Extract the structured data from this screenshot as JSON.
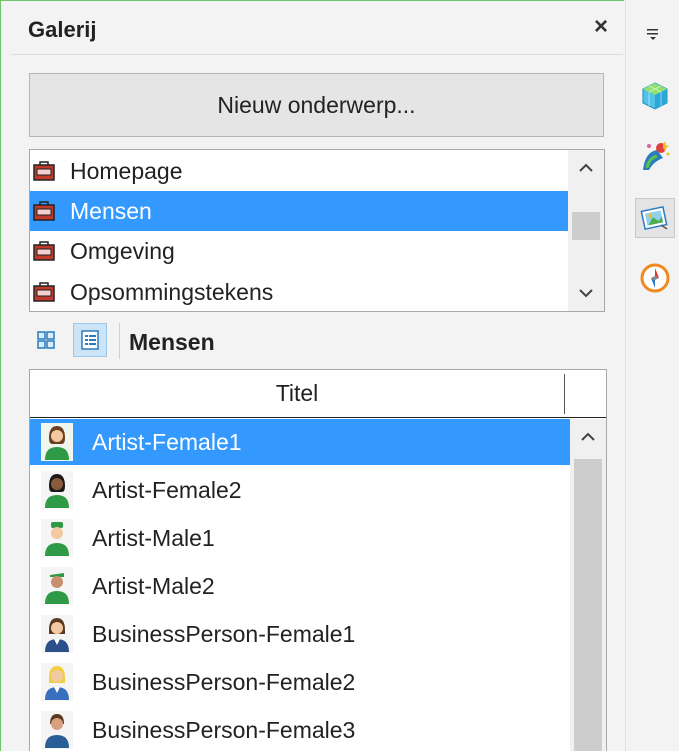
{
  "panel": {
    "title": "Galerij",
    "close_glyph": "×"
  },
  "new_theme_button": "Nieuw onderwerp...",
  "themes": {
    "items": [
      {
        "label": "Homepage",
        "selected": false
      },
      {
        "label": "Mensen",
        "selected": true
      },
      {
        "label": "Omgeving",
        "selected": false
      },
      {
        "label": "Opsommingstekens",
        "selected": false
      }
    ],
    "scroll_up": "^",
    "scroll_down": "v"
  },
  "view": {
    "icon_view": "icon-view-icon",
    "detailed_view": "detail-view-icon",
    "active": "detailed",
    "current_theme": "Mensen"
  },
  "items_table": {
    "column_title": "Titel",
    "rows": [
      {
        "label": "Artist-Female1",
        "selected": true
      },
      {
        "label": "Artist-Female2",
        "selected": false
      },
      {
        "label": "Artist-Male1",
        "selected": false
      },
      {
        "label": "Artist-Male2",
        "selected": false
      },
      {
        "label": "BusinessPerson-Female1",
        "selected": false
      },
      {
        "label": "BusinessPerson-Female2",
        "selected": false
      },
      {
        "label": "BusinessPerson-Female3",
        "selected": false
      }
    ]
  },
  "sidebar_tabs": [
    {
      "name": "sidebar-menu-icon"
    },
    {
      "name": "properties-icon"
    },
    {
      "name": "styles-icon"
    },
    {
      "name": "gallery-icon",
      "active": true
    },
    {
      "name": "navigator-icon"
    }
  ],
  "colors": {
    "selection": "#3399ff",
    "panel_border": "#6bc66b"
  }
}
